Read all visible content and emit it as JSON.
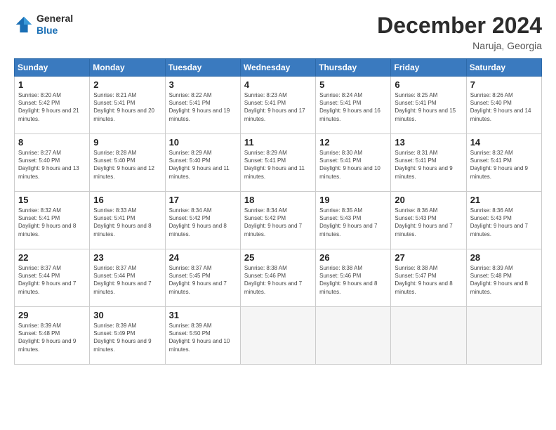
{
  "header": {
    "logo_general": "General",
    "logo_blue": "Blue",
    "month_title": "December 2024",
    "location": "Naruja, Georgia"
  },
  "weekdays": [
    "Sunday",
    "Monday",
    "Tuesday",
    "Wednesday",
    "Thursday",
    "Friday",
    "Saturday"
  ],
  "weeks": [
    [
      {
        "day": "1",
        "sunrise": "8:20 AM",
        "sunset": "5:42 PM",
        "daylight": "9 hours and 21 minutes."
      },
      {
        "day": "2",
        "sunrise": "8:21 AM",
        "sunset": "5:41 PM",
        "daylight": "9 hours and 20 minutes."
      },
      {
        "day": "3",
        "sunrise": "8:22 AM",
        "sunset": "5:41 PM",
        "daylight": "9 hours and 19 minutes."
      },
      {
        "day": "4",
        "sunrise": "8:23 AM",
        "sunset": "5:41 PM",
        "daylight": "9 hours and 17 minutes."
      },
      {
        "day": "5",
        "sunrise": "8:24 AM",
        "sunset": "5:41 PM",
        "daylight": "9 hours and 16 minutes."
      },
      {
        "day": "6",
        "sunrise": "8:25 AM",
        "sunset": "5:41 PM",
        "daylight": "9 hours and 15 minutes."
      },
      {
        "day": "7",
        "sunrise": "8:26 AM",
        "sunset": "5:40 PM",
        "daylight": "9 hours and 14 minutes."
      }
    ],
    [
      {
        "day": "8",
        "sunrise": "8:27 AM",
        "sunset": "5:40 PM",
        "daylight": "9 hours and 13 minutes."
      },
      {
        "day": "9",
        "sunrise": "8:28 AM",
        "sunset": "5:40 PM",
        "daylight": "9 hours and 12 minutes."
      },
      {
        "day": "10",
        "sunrise": "8:29 AM",
        "sunset": "5:40 PM",
        "daylight": "9 hours and 11 minutes."
      },
      {
        "day": "11",
        "sunrise": "8:29 AM",
        "sunset": "5:41 PM",
        "daylight": "9 hours and 11 minutes."
      },
      {
        "day": "12",
        "sunrise": "8:30 AM",
        "sunset": "5:41 PM",
        "daylight": "9 hours and 10 minutes."
      },
      {
        "day": "13",
        "sunrise": "8:31 AM",
        "sunset": "5:41 PM",
        "daylight": "9 hours and 9 minutes."
      },
      {
        "day": "14",
        "sunrise": "8:32 AM",
        "sunset": "5:41 PM",
        "daylight": "9 hours and 9 minutes."
      }
    ],
    [
      {
        "day": "15",
        "sunrise": "8:32 AM",
        "sunset": "5:41 PM",
        "daylight": "9 hours and 8 minutes."
      },
      {
        "day": "16",
        "sunrise": "8:33 AM",
        "sunset": "5:41 PM",
        "daylight": "9 hours and 8 minutes."
      },
      {
        "day": "17",
        "sunrise": "8:34 AM",
        "sunset": "5:42 PM",
        "daylight": "9 hours and 8 minutes."
      },
      {
        "day": "18",
        "sunrise": "8:34 AM",
        "sunset": "5:42 PM",
        "daylight": "9 hours and 7 minutes."
      },
      {
        "day": "19",
        "sunrise": "8:35 AM",
        "sunset": "5:43 PM",
        "daylight": "9 hours and 7 minutes."
      },
      {
        "day": "20",
        "sunrise": "8:36 AM",
        "sunset": "5:43 PM",
        "daylight": "9 hours and 7 minutes."
      },
      {
        "day": "21",
        "sunrise": "8:36 AM",
        "sunset": "5:43 PM",
        "daylight": "9 hours and 7 minutes."
      }
    ],
    [
      {
        "day": "22",
        "sunrise": "8:37 AM",
        "sunset": "5:44 PM",
        "daylight": "9 hours and 7 minutes."
      },
      {
        "day": "23",
        "sunrise": "8:37 AM",
        "sunset": "5:44 PM",
        "daylight": "9 hours and 7 minutes."
      },
      {
        "day": "24",
        "sunrise": "8:37 AM",
        "sunset": "5:45 PM",
        "daylight": "9 hours and 7 minutes."
      },
      {
        "day": "25",
        "sunrise": "8:38 AM",
        "sunset": "5:46 PM",
        "daylight": "9 hours and 7 minutes."
      },
      {
        "day": "26",
        "sunrise": "8:38 AM",
        "sunset": "5:46 PM",
        "daylight": "9 hours and 8 minutes."
      },
      {
        "day": "27",
        "sunrise": "8:38 AM",
        "sunset": "5:47 PM",
        "daylight": "9 hours and 8 minutes."
      },
      {
        "day": "28",
        "sunrise": "8:39 AM",
        "sunset": "5:48 PM",
        "daylight": "9 hours and 8 minutes."
      }
    ],
    [
      {
        "day": "29",
        "sunrise": "8:39 AM",
        "sunset": "5:48 PM",
        "daylight": "9 hours and 9 minutes."
      },
      {
        "day": "30",
        "sunrise": "8:39 AM",
        "sunset": "5:49 PM",
        "daylight": "9 hours and 9 minutes."
      },
      {
        "day": "31",
        "sunrise": "8:39 AM",
        "sunset": "5:50 PM",
        "daylight": "9 hours and 10 minutes."
      },
      null,
      null,
      null,
      null
    ]
  ]
}
